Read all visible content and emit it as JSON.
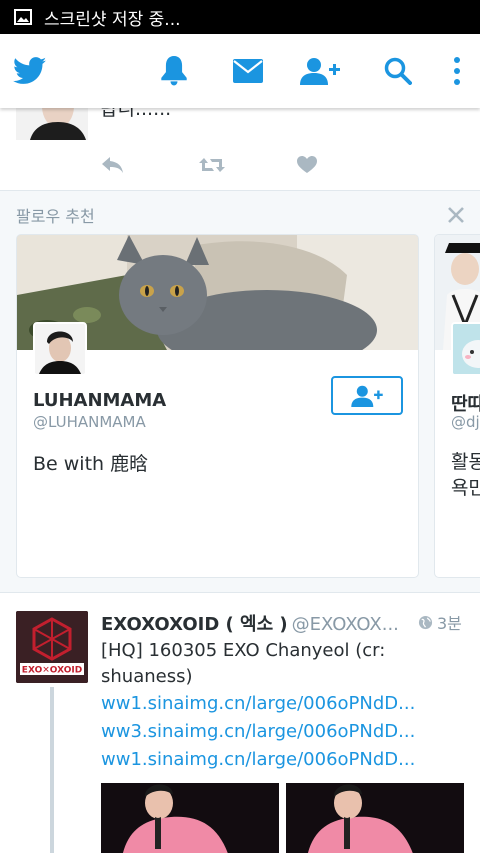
{
  "status_bar": {
    "text": "스크린샷 저장 중..."
  },
  "toolbar": {
    "icons": [
      "twitter-logo-icon",
      "bell-icon",
      "mail-icon",
      "add-user-icon",
      "search-icon",
      "more-vertical-icon"
    ],
    "accent": "#1b95e0"
  },
  "tweet_top": {
    "cut_text": "랍니......"
  },
  "suggestions": {
    "title": "팔로우 추천",
    "cards": [
      {
        "name": "LUHANMAMA",
        "handle": "@LUHANMAMA",
        "bio": "Be with 鹿晗"
      },
      {
        "name": "딴따",
        "handle": "@dj",
        "bio_line1": "활동",
        "bio_line2": "욕만"
      }
    ]
  },
  "tweet2": {
    "name": "EXOXOXOID ( 엑소 )",
    "handle": "@EXOXOX...",
    "time": "3분",
    "text": "[HQ] 160305 EXO Chanyeol (cr: shuaness)",
    "links": [
      "ww1.sinaimg.cn/large/006oPNdD...",
      "ww3.sinaimg.cn/large/006oPNdD...",
      "ww1.sinaimg.cn/large/006oPNdD..."
    ],
    "avatar_label": "EXO✕OXOID"
  }
}
